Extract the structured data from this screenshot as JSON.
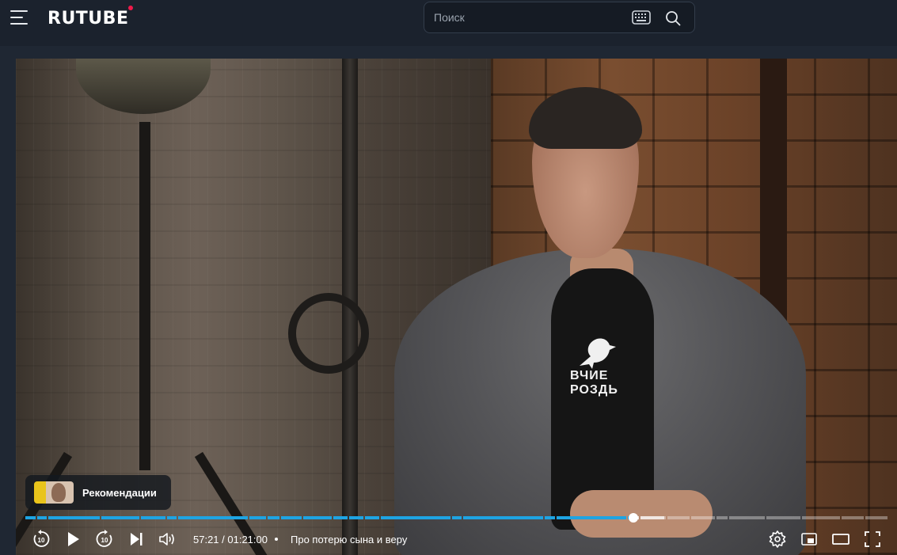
{
  "header": {
    "logo_text": "RUTUBE",
    "search": {
      "placeholder": "Поиск"
    }
  },
  "player": {
    "recommendations_label": "Рекомендации",
    "shirt_print": "ВЧИЕ\nРОЗДЬ",
    "progress": {
      "played_fraction": 0.705,
      "buffered_fraction": 0.74
    },
    "time": {
      "current": "57:21",
      "total": "01:21:00",
      "display": "57:21 / 01:21:00"
    },
    "chapter_title": "Про потерю сына и веру",
    "icons": {
      "rewind": "rewind-10-icon",
      "play": "play-icon",
      "forward": "forward-10-icon",
      "next": "next-icon",
      "volume": "volume-icon",
      "settings": "gear-icon",
      "pip": "picture-in-picture-icon",
      "theater": "theater-mode-icon",
      "fullscreen": "fullscreen-icon"
    }
  },
  "colors": {
    "header_bg": "#1b222d",
    "page_bg": "#1f2733",
    "accent": "#1ea4e3",
    "logo_dot": "#ef1a4a"
  }
}
